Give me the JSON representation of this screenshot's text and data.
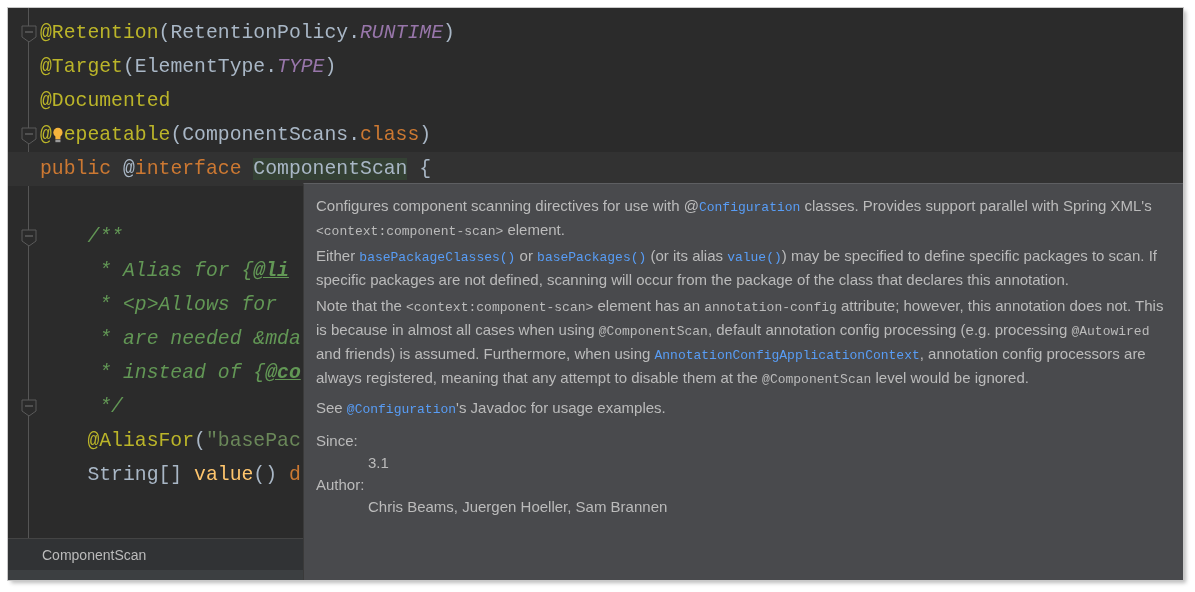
{
  "editor": {
    "lines": [
      {
        "fold": true,
        "current": false,
        "tokens": [
          {
            "kind": "annotation",
            "text": "@Retention"
          },
          {
            "kind": "plain",
            "text": "(RetentionPolicy."
          },
          {
            "kind": "constant",
            "text": "RUNTIME"
          },
          {
            "kind": "plain",
            "text": ")"
          }
        ]
      },
      {
        "fold": false,
        "current": false,
        "tokens": [
          {
            "kind": "annotation",
            "text": "@Target"
          },
          {
            "kind": "plain",
            "text": "(ElementType."
          },
          {
            "kind": "constant",
            "text": "TYPE"
          },
          {
            "kind": "plain",
            "text": ")"
          }
        ]
      },
      {
        "fold": false,
        "current": false,
        "tokens": [
          {
            "kind": "annotation",
            "text": "@Documented"
          }
        ]
      },
      {
        "fold": true,
        "current": false,
        "tokens": [
          {
            "kind": "annotation",
            "text": "@"
          },
          {
            "kind": "bulb"
          },
          {
            "kind": "annotation",
            "text": "epeatable"
          },
          {
            "kind": "plain",
            "text": "(ComponentScans."
          },
          {
            "kind": "keyword",
            "text": "class"
          },
          {
            "kind": "plain",
            "text": ")"
          }
        ]
      },
      {
        "fold": false,
        "current": true,
        "tokens": [
          {
            "kind": "keyword",
            "text": "public "
          },
          {
            "kind": "annotation-kw",
            "text": "@"
          },
          {
            "kind": "keyword",
            "text": "interface "
          },
          {
            "kind": "highlight",
            "text": "ComponentScan"
          },
          {
            "kind": "plain",
            "text": " {"
          }
        ]
      },
      {
        "fold": true,
        "current": false,
        "tokens": [
          {
            "kind": "doc",
            "text": "    /**"
          }
        ]
      },
      {
        "fold": false,
        "current": false,
        "tokens": [
          {
            "kind": "doc",
            "text": "     * Alias for {"
          },
          {
            "kind": "doc-tag",
            "text": "@li"
          }
        ]
      },
      {
        "fold": false,
        "current": false,
        "tokens": [
          {
            "kind": "doc",
            "text": "     * <p>Allows for"
          }
        ]
      },
      {
        "fold": false,
        "current": false,
        "tokens": [
          {
            "kind": "doc",
            "text": "     * are needed &mda"
          }
        ]
      },
      {
        "fold": false,
        "current": false,
        "tokens": [
          {
            "kind": "doc",
            "text": "     * instead of {"
          },
          {
            "kind": "doc-tag",
            "text": "@co"
          }
        ]
      },
      {
        "fold": true,
        "current": false,
        "tokens": [
          {
            "kind": "doc",
            "text": "     */"
          }
        ]
      },
      {
        "fold": false,
        "current": false,
        "tokens": [
          {
            "kind": "annotation",
            "text": "    @AliasFor"
          },
          {
            "kind": "plain",
            "text": "("
          },
          {
            "kind": "string",
            "text": "\"basePac"
          }
        ]
      },
      {
        "fold": false,
        "current": false,
        "tokens": [
          {
            "kind": "plain",
            "text": "    String[] "
          },
          {
            "kind": "method",
            "text": "value"
          },
          {
            "kind": "plain",
            "text": "() "
          },
          {
            "kind": "keyword",
            "text": "d"
          }
        ]
      }
    ]
  },
  "breadcrumb": "ComponentScan",
  "doc_popup": {
    "paragraphs": [
      [
        {
          "kind": "text",
          "text": "Configures component scanning directives for use with @"
        },
        {
          "kind": "link",
          "text": "Configuration"
        },
        {
          "kind": "text",
          "text": " classes. Provides support parallel with Spring XML's "
        },
        {
          "kind": "code",
          "text": "<context:component-scan>"
        },
        {
          "kind": "text",
          "text": " element."
        }
      ],
      [
        {
          "kind": "text",
          "text": "Either "
        },
        {
          "kind": "link",
          "text": "basePackageClasses()"
        },
        {
          "kind": "text",
          "text": " or "
        },
        {
          "kind": "link",
          "text": "basePackages()"
        },
        {
          "kind": "text",
          "text": " (or its alias "
        },
        {
          "kind": "link",
          "text": "value()"
        },
        {
          "kind": "text",
          "text": ") may be specified to define specific packages to scan. If specific packages are not defined, scanning will occur from the package of the class that declares this annotation."
        }
      ],
      [
        {
          "kind": "text",
          "text": "Note that the "
        },
        {
          "kind": "code",
          "text": "<context:component-scan>"
        },
        {
          "kind": "text",
          "text": " element has an "
        },
        {
          "kind": "code",
          "text": "annotation-config"
        },
        {
          "kind": "text",
          "text": " attribute; however, this annotation does not. This is because in almost all cases when using "
        },
        {
          "kind": "code",
          "text": "@ComponentScan"
        },
        {
          "kind": "text",
          "text": ", default annotation config processing (e.g. processing "
        },
        {
          "kind": "code",
          "text": "@Autowired"
        },
        {
          "kind": "text",
          "text": " and friends) is assumed. Furthermore, when using "
        },
        {
          "kind": "link",
          "text": "AnnotationConfigApplicationContext"
        },
        {
          "kind": "text",
          "text": ", annotation config processors are always registered, meaning that any attempt to disable them at the "
        },
        {
          "kind": "code",
          "text": "@ComponentScan"
        },
        {
          "kind": "text",
          "text": " level would be ignored."
        }
      ],
      [
        {
          "kind": "text",
          "text": "See "
        },
        {
          "kind": "link",
          "text": "@Configuration"
        },
        {
          "kind": "text",
          "text": "'s Javadoc for usage examples."
        }
      ]
    ],
    "sections": [
      {
        "label": "Since:",
        "value": "3.1"
      },
      {
        "label": "Author:",
        "value": "Chris Beams, Juergen Hoeller, Sam Brannen"
      }
    ]
  }
}
